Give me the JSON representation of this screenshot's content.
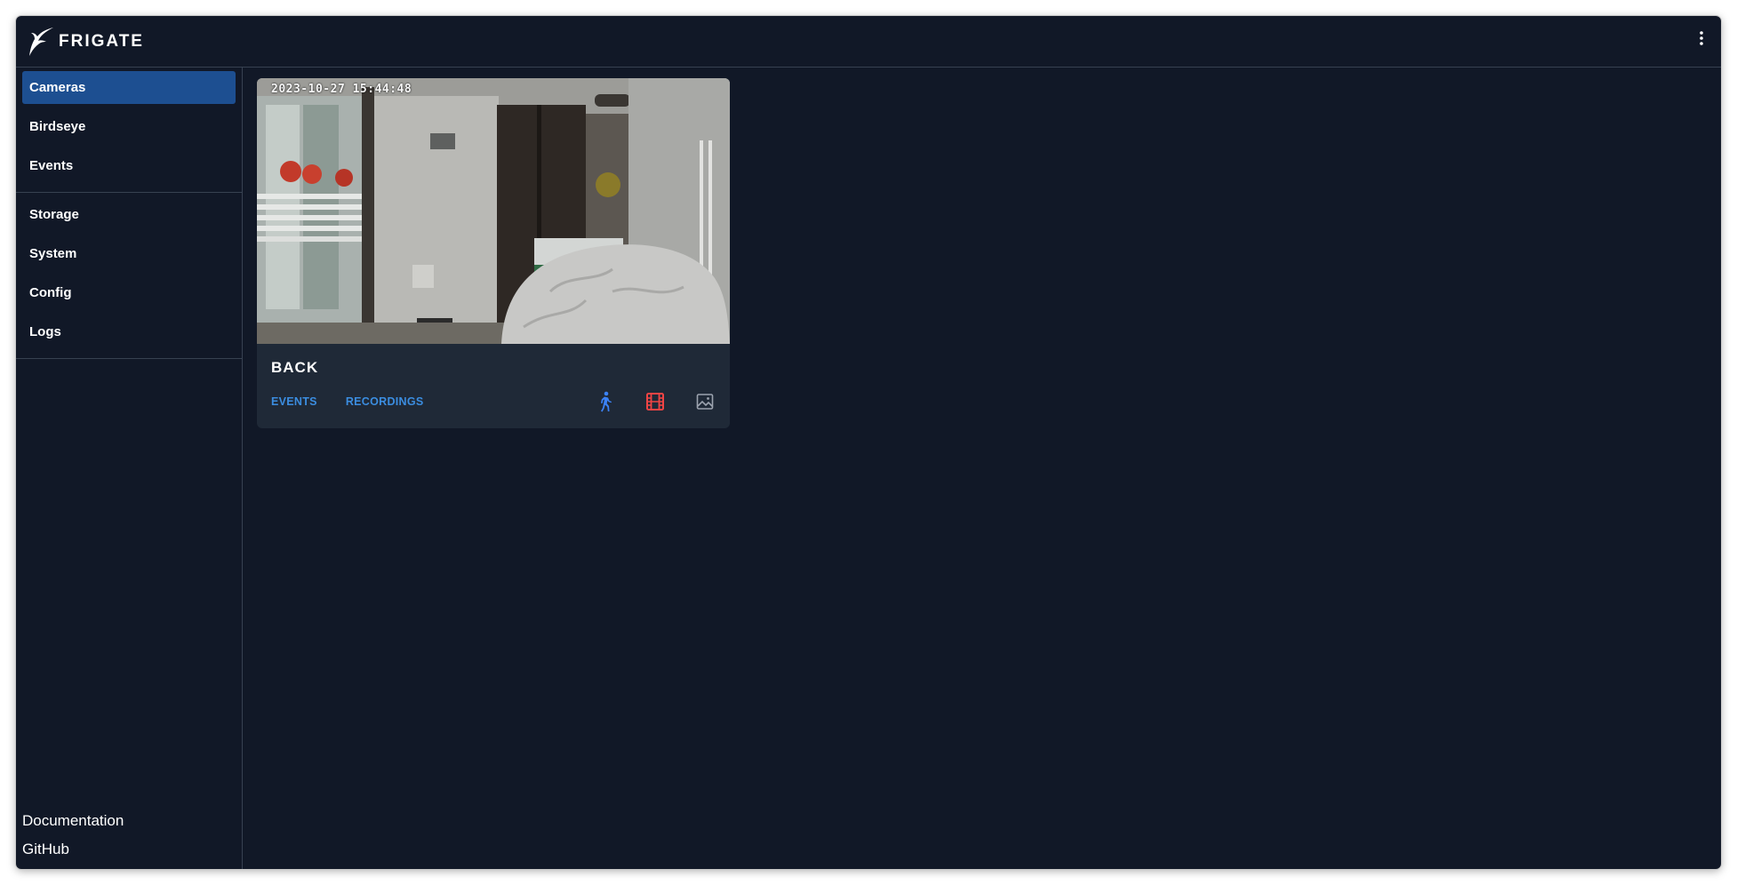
{
  "app": {
    "name": "FRIGATE",
    "colors": {
      "background": "#111827",
      "card": "#1f2937",
      "accent": "#1d4f91",
      "link": "#3b8de0",
      "detect_icon": "#3b82f6",
      "recordings_icon": "#ef4444",
      "snapshots_icon": "#9ca3af"
    }
  },
  "header": {
    "logo_icon": "frigate-bird-icon",
    "menu_icon": "kebab-menu-icon"
  },
  "sidebar": {
    "primary": [
      {
        "label": "Cameras",
        "active": true
      },
      {
        "label": "Birdseye",
        "active": false
      },
      {
        "label": "Events",
        "active": false
      }
    ],
    "secondary": [
      {
        "label": "Storage"
      },
      {
        "label": "System"
      },
      {
        "label": "Config"
      },
      {
        "label": "Logs"
      }
    ],
    "footer": [
      {
        "label": "Documentation"
      },
      {
        "label": "GitHub"
      }
    ]
  },
  "cameras": [
    {
      "name": "BACK",
      "timestamp": "2023-10-27  15:44:48",
      "links": {
        "events": "EVENTS",
        "recordings": "RECORDINGS"
      },
      "toggles": [
        {
          "icon": "person-walking-icon",
          "name": "detect",
          "enabled": true
        },
        {
          "icon": "film-icon",
          "name": "recordings",
          "enabled": true
        },
        {
          "icon": "image-icon",
          "name": "snapshots",
          "enabled": false
        }
      ]
    }
  ]
}
